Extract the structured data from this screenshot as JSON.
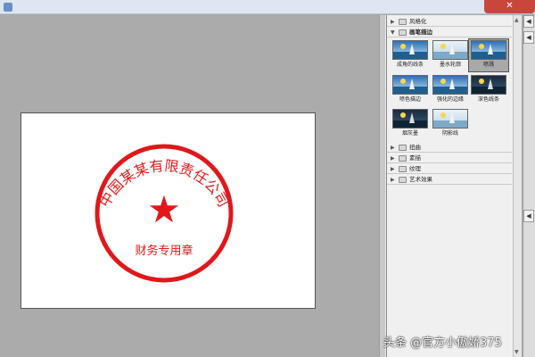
{
  "window": {
    "title": "",
    "close_glyph": "✕"
  },
  "stamp": {
    "company": "中国某某有限责任公司",
    "department": "财务专用章",
    "star_glyph": "★",
    "color": "#e0181b"
  },
  "filter_gallery": {
    "folders_top": [
      {
        "label": "风格化",
        "expanded": false
      }
    ],
    "open_folder": {
      "label": "画笔描边",
      "expanded": true
    },
    "thumbnails": [
      {
        "label": "成角的线条",
        "selected": false
      },
      {
        "label": "墨水轮廓",
        "selected": false
      },
      {
        "label": "喷溅",
        "selected": true
      },
      {
        "label": "喷色描边",
        "selected": false
      },
      {
        "label": "强化的边缘",
        "selected": false
      },
      {
        "label": "深色线条",
        "selected": false
      },
      {
        "label": "烟灰墨",
        "selected": false
      },
      {
        "label": "阴影线",
        "selected": false
      }
    ],
    "folders_bottom": [
      {
        "label": "扭曲",
        "expanded": false
      },
      {
        "label": "素描",
        "expanded": false
      },
      {
        "label": "纹理",
        "expanded": false
      },
      {
        "label": "艺术效果",
        "expanded": false
      }
    ]
  },
  "icons": {
    "collapsed_triangle": "▶",
    "expanded_triangle": "▼",
    "scroll_up": "▲",
    "scroll_down": "▼",
    "side_toggle": "◀"
  },
  "watermark": "头条 @官方小傲娇375"
}
